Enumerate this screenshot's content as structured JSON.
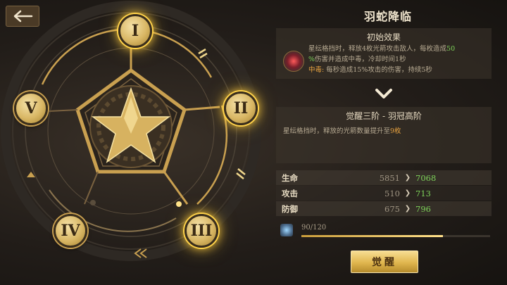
{
  "header": {
    "back_icon": "back-arrow-icon"
  },
  "wheel": {
    "nodes": [
      {
        "label": "I",
        "active": true
      },
      {
        "label": "II",
        "active": true
      },
      {
        "label": "III",
        "active": true
      },
      {
        "label": "IV",
        "active": false
      },
      {
        "label": "V",
        "active": false
      }
    ],
    "center_icon": "star-gear-emblem-icon"
  },
  "skill": {
    "title": "羽蛇降临",
    "initial": {
      "heading": "初始效果",
      "icon": "serpent-skill-icon",
      "line1a": "星纭格挡时，释放4枚光箭攻击敌人，每枚造成",
      "line1b": "50",
      "line2a": "%",
      "line2b": "伤害并造成中毒，冷却时间1秒",
      "line3a": "中毒:",
      "line3b": " 每秒造成15%攻击的伤害，持续5秒"
    },
    "awaken": {
      "heading": "觉醒三阶 - 羽冠高阶",
      "desc_a": "星纭格挡时，释放的光箭数量提升至",
      "desc_b": "9枚"
    }
  },
  "stats": [
    {
      "label": "生命",
      "old": "5851",
      "new": "7068"
    },
    {
      "label": "攻击",
      "old": "510",
      "new": "713"
    },
    {
      "label": "防御",
      "old": "675",
      "new": "796"
    }
  ],
  "material": {
    "icon": "crystal-material-icon",
    "count": "90/120",
    "progress": 0.75
  },
  "action": {
    "awaken_label": "觉醒"
  },
  "colors": {
    "accent_gold": "#e0b64e",
    "stat_up": "#7ed35a",
    "poison": "#e9a340"
  }
}
